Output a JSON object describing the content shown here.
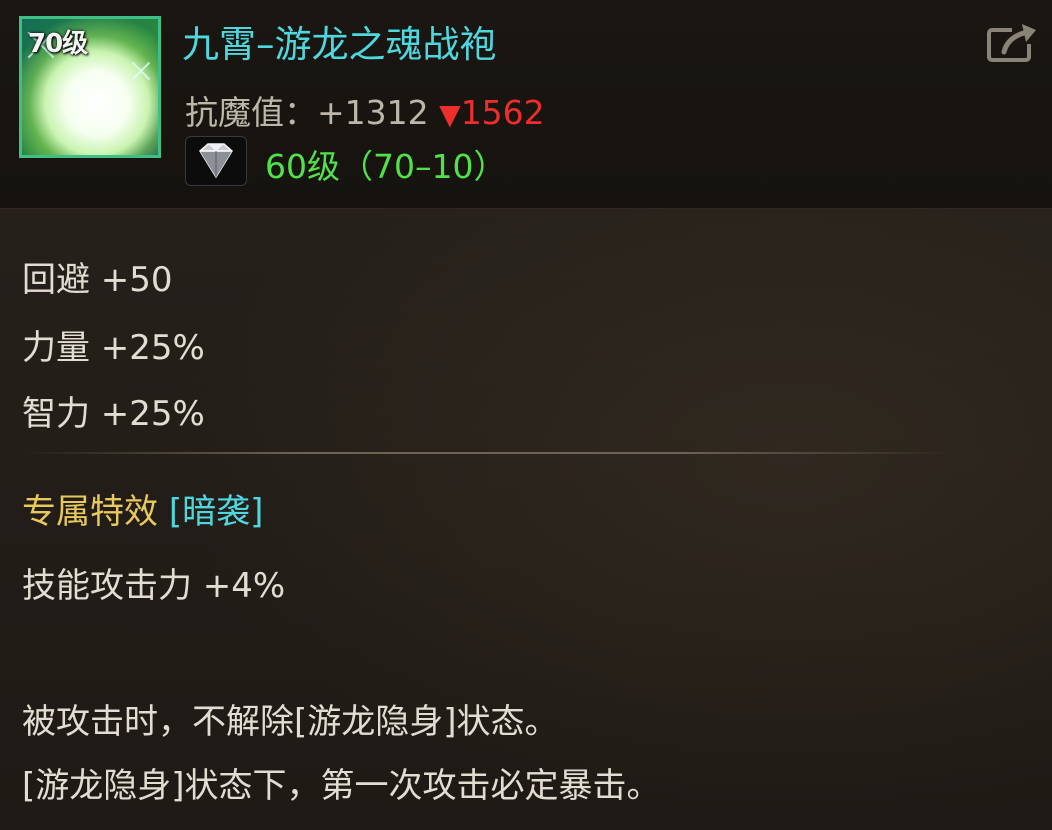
{
  "item": {
    "level_badge": "70级",
    "name": "九霄–游龙之魂战袍",
    "stat_label": "抗魔值：",
    "stat_value": "+1312",
    "compare_arrow": "▼",
    "compare_value": "1562",
    "gem_icon": "diamond-gem-icon",
    "gem_text": "60级（70–10）"
  },
  "attributes": [
    "回避 +50",
    "力量 +25%",
    "智力 +25%"
  ],
  "special": {
    "label": "专属特效 ",
    "tag": "[暗袭]",
    "effect": "技能攻击力 +4%",
    "description_lines": [
      "被攻击时，不解除[游龙隐身]状态。",
      "[游龙隐身]状态下，第一次攻击必定暴击。"
    ]
  },
  "colors": {
    "name": "#4fd7e0",
    "compare_down": "#ee2d2d",
    "gem_text": "#51e24a",
    "special_label": "#e8c95c",
    "body_text": "#e2ddd3"
  }
}
